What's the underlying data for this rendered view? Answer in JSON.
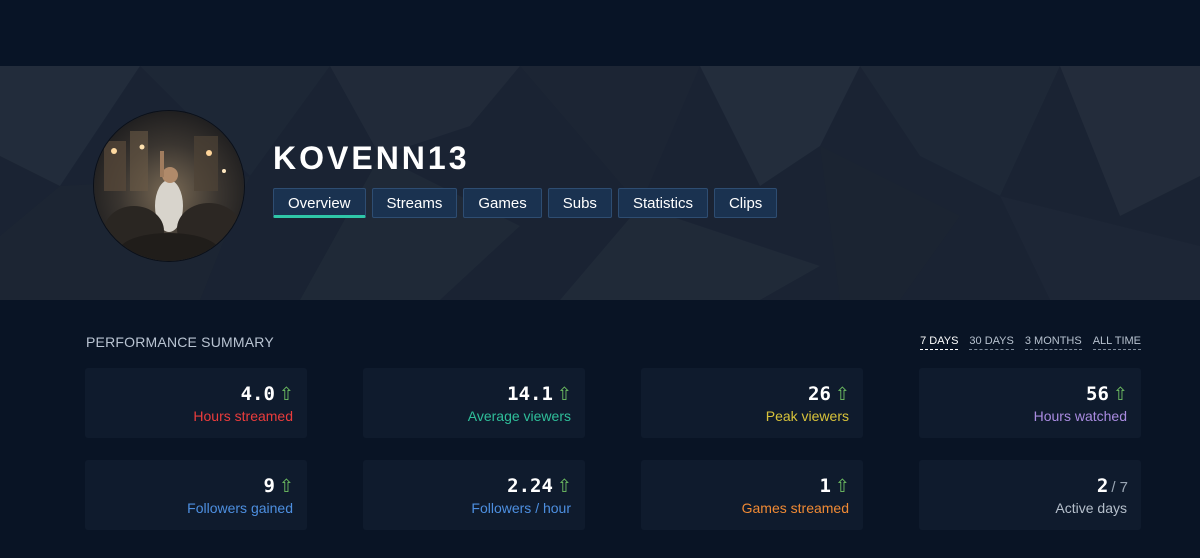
{
  "channel": {
    "name": "KOVENN13"
  },
  "tabs": [
    {
      "label": "Overview",
      "active": true
    },
    {
      "label": "Streams",
      "active": false
    },
    {
      "label": "Games",
      "active": false
    },
    {
      "label": "Subs",
      "active": false
    },
    {
      "label": "Statistics",
      "active": false
    },
    {
      "label": "Clips",
      "active": false
    }
  ],
  "performance": {
    "title": "PERFORMANCE SUMMARY",
    "ranges": [
      {
        "label": "7 DAYS",
        "active": true
      },
      {
        "label": "30 DAYS",
        "active": false
      },
      {
        "label": "3 MONTHS",
        "active": false
      },
      {
        "label": "ALL TIME",
        "active": false
      }
    ],
    "cards": [
      {
        "value": "4.0",
        "trend_icon": "arrow-up-icon",
        "label": "Hours streamed",
        "color": "#ea3c3c"
      },
      {
        "value": "14.1",
        "trend_icon": "arrow-up-icon",
        "label": "Average viewers",
        "color": "#2fbf9a"
      },
      {
        "value": "26",
        "trend_icon": "arrow-up-icon",
        "label": "Peak viewers",
        "color": "#d8c33a"
      },
      {
        "value": "56",
        "trend_icon": "arrow-up-icon",
        "label": "Hours watched",
        "color": "#a98be0"
      },
      {
        "value": "9",
        "trend_icon": "arrow-up-icon",
        "label": "Followers gained",
        "color": "#4d8fe0"
      },
      {
        "value": "2.24",
        "trend_icon": "arrow-up-icon",
        "label": "Followers / hour",
        "color": "#4d8fe0"
      },
      {
        "value": "1",
        "trend_icon": "arrow-up-icon",
        "label": "Games streamed",
        "color": "#f08a34"
      },
      {
        "value": "2",
        "denominator": "/ 7",
        "label": "Active days",
        "color": "#b5bfcb"
      }
    ]
  },
  "colors": {
    "arrow": "#6fbf62",
    "tab_active_underline": "#2fc7a8",
    "background": "#091425"
  }
}
